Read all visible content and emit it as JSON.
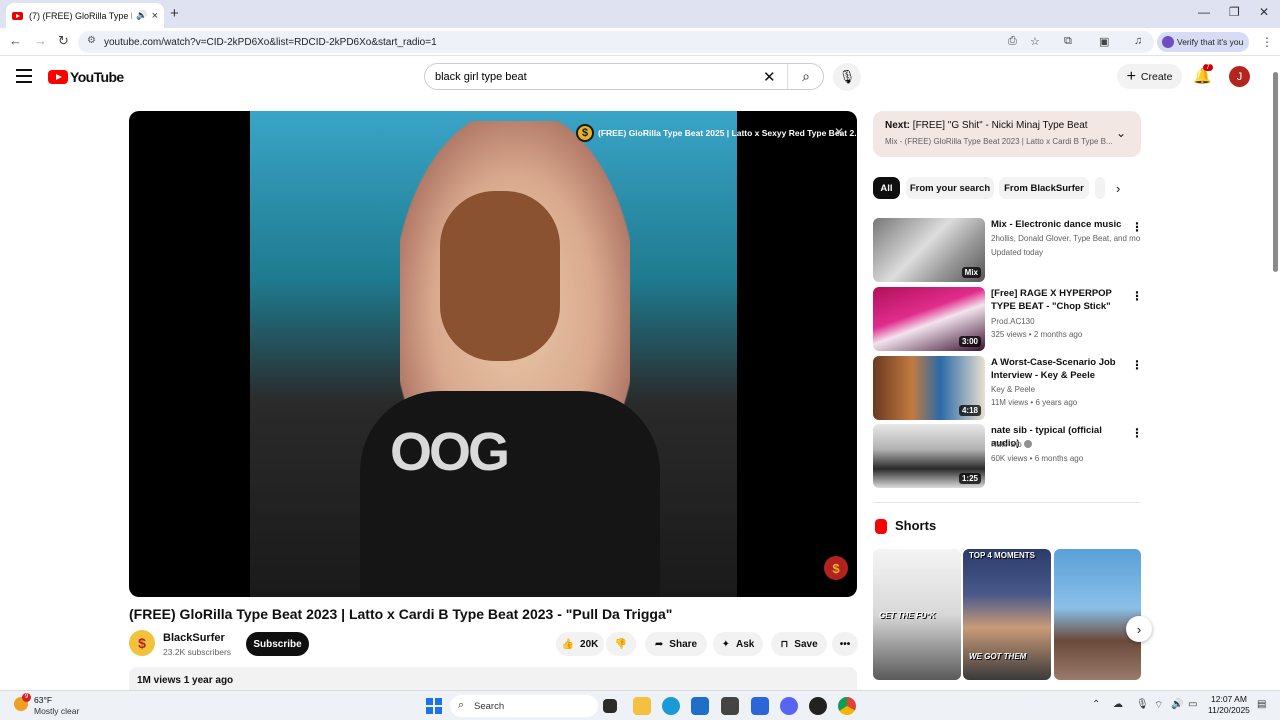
{
  "browser": {
    "tab_title": "(7) (FREE) GloRilla Type Beat",
    "url": "youtube.com/watch?v=CID-2kPD6Xo&list=RDCID-2kPD6Xo&start_radio=1",
    "verify_label": "Verify that it's you"
  },
  "header": {
    "logo_text": "YouTube",
    "search_value": "black girl type beat",
    "create_label": "Create",
    "notification_count": "7",
    "avatar_initial": "J"
  },
  "player": {
    "overlay_title": "(FREE) GloRilla Type Beat 2025 | Latto x Sexyy Red Type Beat 2...",
    "channel_coin": "$",
    "shirt_text": "OOG"
  },
  "video": {
    "title": "(FREE) GloRilla Type Beat 2023 | Latto x Cardi B Type Beat 2023 - \"Pull Da Trigga\"",
    "channel_name": "BlackSurfer",
    "subscribers": "23.2K subscribers",
    "subscribe_label": "Subscribe",
    "likes": "20K",
    "share_label": "Share",
    "ask_label": "Ask",
    "save_label": "Save",
    "views_date": "1M views  1 year ago"
  },
  "up_next": {
    "label": "Next:",
    "title": "[FREE] \"G Shit\" - Nicki Minaj Type Beat",
    "subtitle": "Mix - (FREE) GloRilla Type Beat 2023 | Latto x Cardi B Type B..."
  },
  "chips": [
    "All",
    "From your search",
    "From BlackSurfer"
  ],
  "recommendations": [
    {
      "title": "Mix - Electronic dance music",
      "meta1": "2hollis, Donald Glover, Type Beat, and mo...",
      "meta2": "Updated today",
      "badge": "Mix"
    },
    {
      "title": "[Free] RAGE X HYPERPOP TYPE BEAT - \"Chop Stick\"",
      "meta1": "Prod.AC130",
      "meta2": "325 views • 2 months ago",
      "badge": "3:00"
    },
    {
      "title": "A Worst-Case-Scenario Job Interview - Key & Peele",
      "meta1": "Key & Peele",
      "meta2": "11M views • 6 years ago",
      "badge": "4:18"
    },
    {
      "title": "nate sib - typical (official audio)",
      "meta1": "Nate Sib",
      "meta2": "60K views • 6 months ago",
      "badge": "1:25"
    }
  ],
  "shorts": {
    "title": "Shorts",
    "captions": [
      "GET THE FU*K",
      "WE GOT THEM",
      ""
    ],
    "top_caption": "TOP 4 MOMENTS"
  },
  "taskbar": {
    "temperature": "63°F",
    "condition": "Mostly clear",
    "weather_badge": "9",
    "search_label": "Search",
    "time": "12:07 AM",
    "date": "11/20/2025"
  }
}
